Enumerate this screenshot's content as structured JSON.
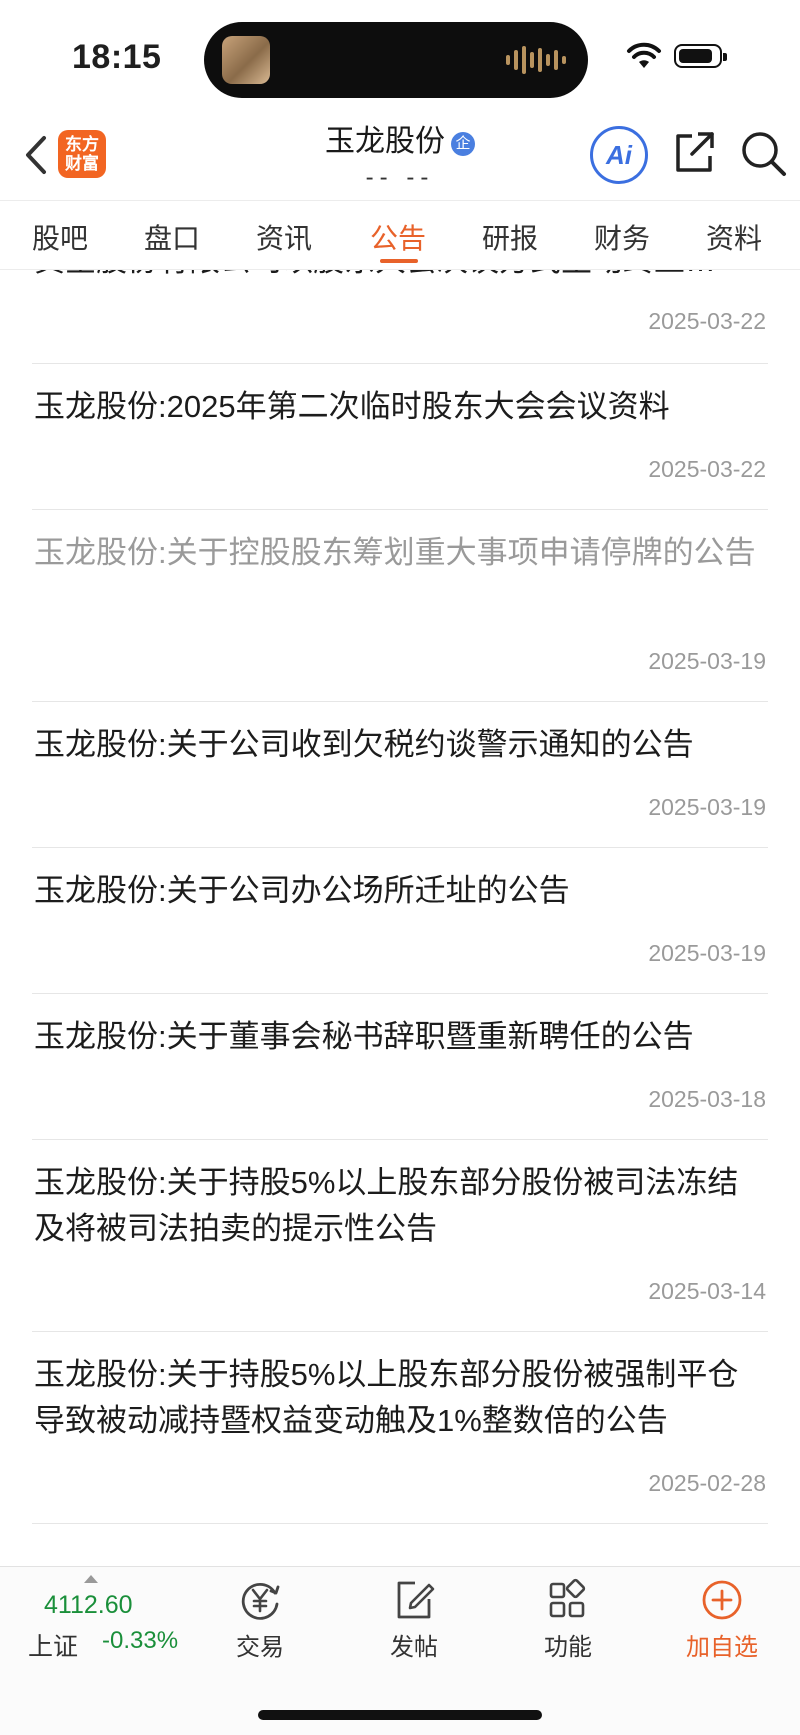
{
  "status": {
    "time": "18:15"
  },
  "header": {
    "app_logo_line1": "东方",
    "app_logo_line2": "财富",
    "title": "玉龙股份",
    "badge": "企",
    "subtitle": "-- --",
    "ai_label": "Ai"
  },
  "tabs": [
    {
      "label": "股吧"
    },
    {
      "label": "盘口"
    },
    {
      "label": "资讯"
    },
    {
      "label": "公告",
      "active": true
    },
    {
      "label": "研报"
    },
    {
      "label": "财务"
    },
    {
      "label": "资料"
    }
  ],
  "announcements": [
    {
      "title": "黄金股份有限公司以股东大会决议方式主动终止…",
      "date": "2025-03-22",
      "read": false
    },
    {
      "title": "玉龙股份:2025年第二次临时股东大会会议资料",
      "date": "2025-03-22",
      "read": false
    },
    {
      "title": "玉龙股份:关于控股股东筹划重大事项申请停牌的公告",
      "date": "2025-03-19",
      "read": true
    },
    {
      "title": "玉龙股份:关于公司收到欠税约谈警示通知的公告",
      "date": "2025-03-19",
      "read": false
    },
    {
      "title": "玉龙股份:关于公司办公场所迁址的公告",
      "date": "2025-03-19",
      "read": false
    },
    {
      "title": "玉龙股份:关于董事会秘书辞职暨重新聘任的公告",
      "date": "2025-03-18",
      "read": false
    },
    {
      "title": "玉龙股份:关于持股5%以上股东部分股份被司法冻结及将被司法拍卖的提示性公告",
      "date": "2025-03-14",
      "read": false
    },
    {
      "title": "玉龙股份:关于持股5%以上股东部分股份被强制平仓导致被动减持暨权益变动触及1%整数倍的公告",
      "date": "2025-02-28",
      "read": false
    }
  ],
  "bottom_bar": {
    "index_value": "4112.60",
    "index_name": "上证",
    "index_change": "-0.33%",
    "nav": [
      {
        "label": "交易",
        "icon": "trade-yen-icon"
      },
      {
        "label": "发帖",
        "icon": "compose-icon"
      },
      {
        "label": "功能",
        "icon": "grid-apps-icon"
      },
      {
        "label": "加自选",
        "icon": "add-circle-icon"
      }
    ]
  },
  "colors": {
    "accent": "#e8622a",
    "ai_blue": "#3b6fe0",
    "index_green": "#1a8f3a"
  }
}
